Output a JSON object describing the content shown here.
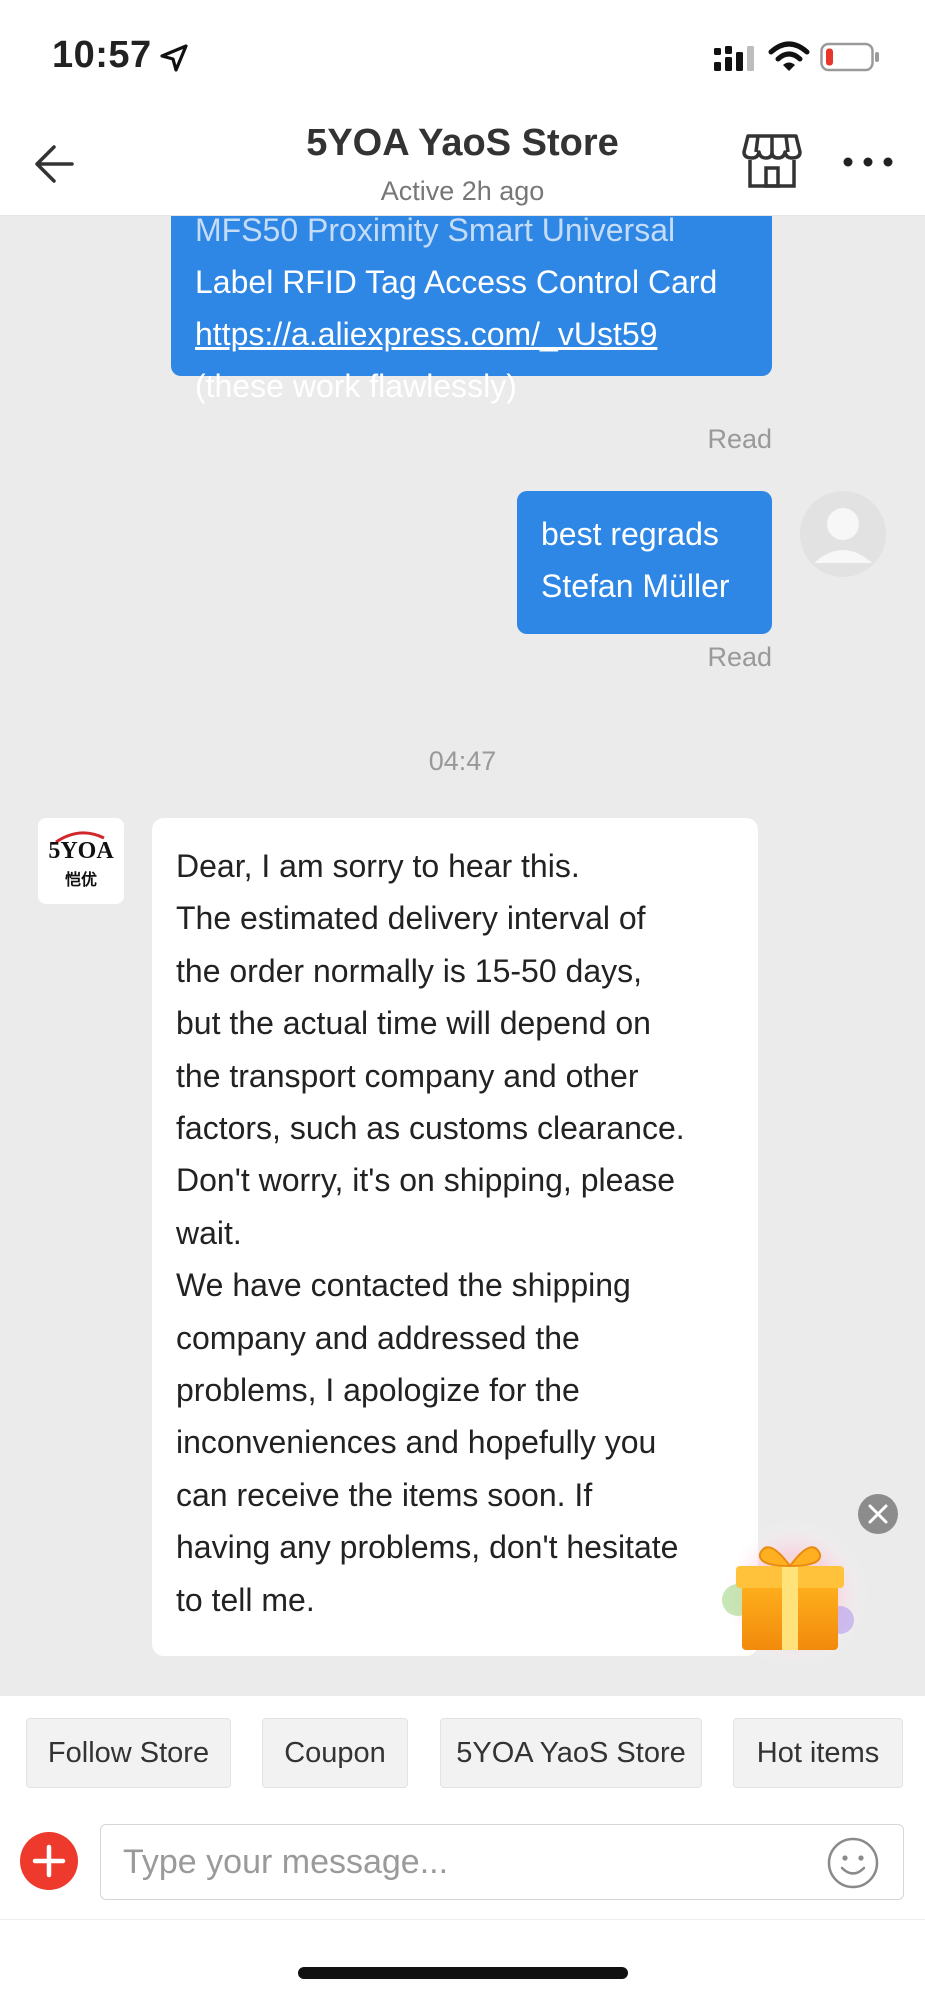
{
  "status_bar": {
    "time": "10:57",
    "location_icon": "location-arrow-icon",
    "signal_icon": "cellular-signal-icon",
    "wifi_icon": "wifi-icon",
    "battery_icon": "battery-low-icon",
    "battery_level": 0.12
  },
  "header": {
    "back_icon": "back-arrow-icon",
    "title": "5YOA YaoS Store",
    "subtitle": "Active 2h ago",
    "store_icon": "storefront-icon",
    "more_icon": "more-dots-icon"
  },
  "messages": {
    "outgoing_1": {
      "line_cut": "MFS50 Proximity Smart Universal",
      "line_1": "Label RFID Tag Access Control Card",
      "link": "https://a.aliexpress.com/_vUst59",
      "line_3": "(these work flawlessly)",
      "status": "Read"
    },
    "outgoing_2": {
      "line_1": "best regrads",
      "line_2": "Stefan Müller",
      "status": "Read"
    },
    "timestamp": "04:47",
    "store_avatar": {
      "logo_text": "5YOA",
      "logo_sub": "恺优"
    },
    "incoming_1": {
      "lines": [
        "Dear, I am sorry to hear this.",
        "The estimated delivery interval of",
        "the order normally is 15-50 days,",
        "but the actual time will depend on",
        "the transport company and other",
        "factors, such as customs clearance.",
        "Don't worry, it's on shipping, please",
        "wait.",
        "We have contacted the shipping",
        "company and addressed the",
        "problems, I apologize for the",
        "inconveniences and hopefully you",
        "can receive the items soon. If",
        "having any problems, don't hesitate",
        "to tell me."
      ]
    }
  },
  "floating": {
    "gift_icon": "gift-box-icon",
    "close_icon": "close-icon"
  },
  "quick_actions": {
    "follow_store": "Follow Store",
    "coupon": "Coupon",
    "store_name": "5YOA YaoS Store",
    "hot_items": "Hot items"
  },
  "input": {
    "placeholder": "Type your message...",
    "plus_icon": "plus-icon",
    "emoji_icon": "emoji-smile-icon"
  },
  "colors": {
    "accent_blue": "#2e86e5",
    "chat_background": "#ebebeb",
    "plus_red": "#ee3a2c",
    "battery_red": "#e8362b"
  }
}
